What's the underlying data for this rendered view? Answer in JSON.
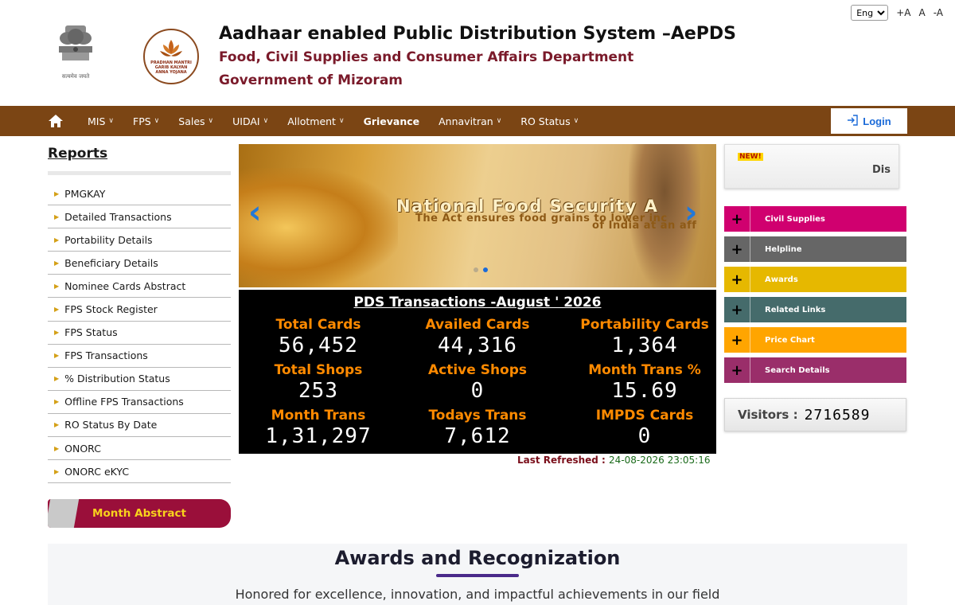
{
  "topbar": {
    "language": "Eng",
    "font_increase": "+A",
    "font_normal": "A",
    "font_decrease": "-A"
  },
  "header": {
    "title": "Aadhaar enabled Public Distribution System –AePDS",
    "department": "Food, Civil Supplies and Consumer Affairs Department",
    "government": "Government of Mizoram",
    "emblem_motto": "सत्यमेव जयते",
    "pmgkay_logo_text": [
      "PRADHAN MANTRI",
      "GARIB KALYAN",
      "ANNA YOJANA"
    ]
  },
  "nav": {
    "items": [
      {
        "label": "MIS",
        "dropdown": true
      },
      {
        "label": "FPS",
        "dropdown": true
      },
      {
        "label": "Sales",
        "dropdown": true
      },
      {
        "label": "UIDAI",
        "dropdown": true
      },
      {
        "label": "Allotment",
        "dropdown": true
      },
      {
        "label": "Grievance",
        "dropdown": false
      },
      {
        "label": "Annavitran",
        "dropdown": true
      },
      {
        "label": "RO Status",
        "dropdown": true
      }
    ],
    "login_label": "Login"
  },
  "sidebar": {
    "title": "Reports",
    "items": [
      "PMGKAY",
      "Detailed Transactions",
      "Portability Details",
      "Beneficiary Details",
      "Nominee Cards Abstract",
      "FPS Stock Register",
      "FPS Status",
      "FPS Transactions",
      "% Distribution Status",
      "Offline FPS Transactions",
      "RO Status By Date",
      "ONORC",
      "ONORC eKYC"
    ],
    "month_abstract_label": "Month Abstract"
  },
  "slider": {
    "title": "National Food Security A",
    "subtitle_line1": "The Act ensures food grains to lower inc",
    "subtitle_line2": "of India at an aff",
    "active_dot": 1,
    "dot_count": 2
  },
  "stats": {
    "title": "PDS Transactions -August ' 2026",
    "items": [
      {
        "label": "Total Cards",
        "value": "56,452"
      },
      {
        "label": "Availed Cards",
        "value": "44,316"
      },
      {
        "label": "Portability Cards",
        "value": "1,364"
      },
      {
        "label": "Total Shops",
        "value": "253"
      },
      {
        "label": "Active Shops",
        "value": "0"
      },
      {
        "label": "Month Trans %",
        "value": "15.69"
      },
      {
        "label": "Month Trans",
        "value": "1,31,297"
      },
      {
        "label": "Todays Trans",
        "value": "7,612"
      },
      {
        "label": "IMPDS Cards",
        "value": "0"
      }
    ],
    "last_refreshed_label": "Last Refreshed :",
    "last_refreshed_value": "24-08-2026 23:05:16"
  },
  "news": {
    "badge": "NEW!",
    "text": "Dis"
  },
  "quick_links": [
    {
      "label": "Civil Supplies",
      "color": "#d0006f"
    },
    {
      "label": "Helpline",
      "color": "#666666"
    },
    {
      "label": "Awards",
      "color": "#e6b800"
    },
    {
      "label": "Related Links",
      "color": "#456b6b"
    },
    {
      "label": "Price Chart",
      "color": "#ffa500"
    },
    {
      "label": "Search Details",
      "color": "#9a2e6a"
    }
  ],
  "visitors": {
    "label": "Visitors :",
    "count": "2716589"
  },
  "awards": {
    "title": "Awards and Recognization",
    "subtitle": "Honored for excellence, innovation, and impactful achievements in our field"
  },
  "colors": {
    "nav_bg": "#7b4514",
    "dept_text": "#7a1a2a",
    "stat_label": "#ff8a00",
    "accent_blue": "#1a6ad8"
  }
}
